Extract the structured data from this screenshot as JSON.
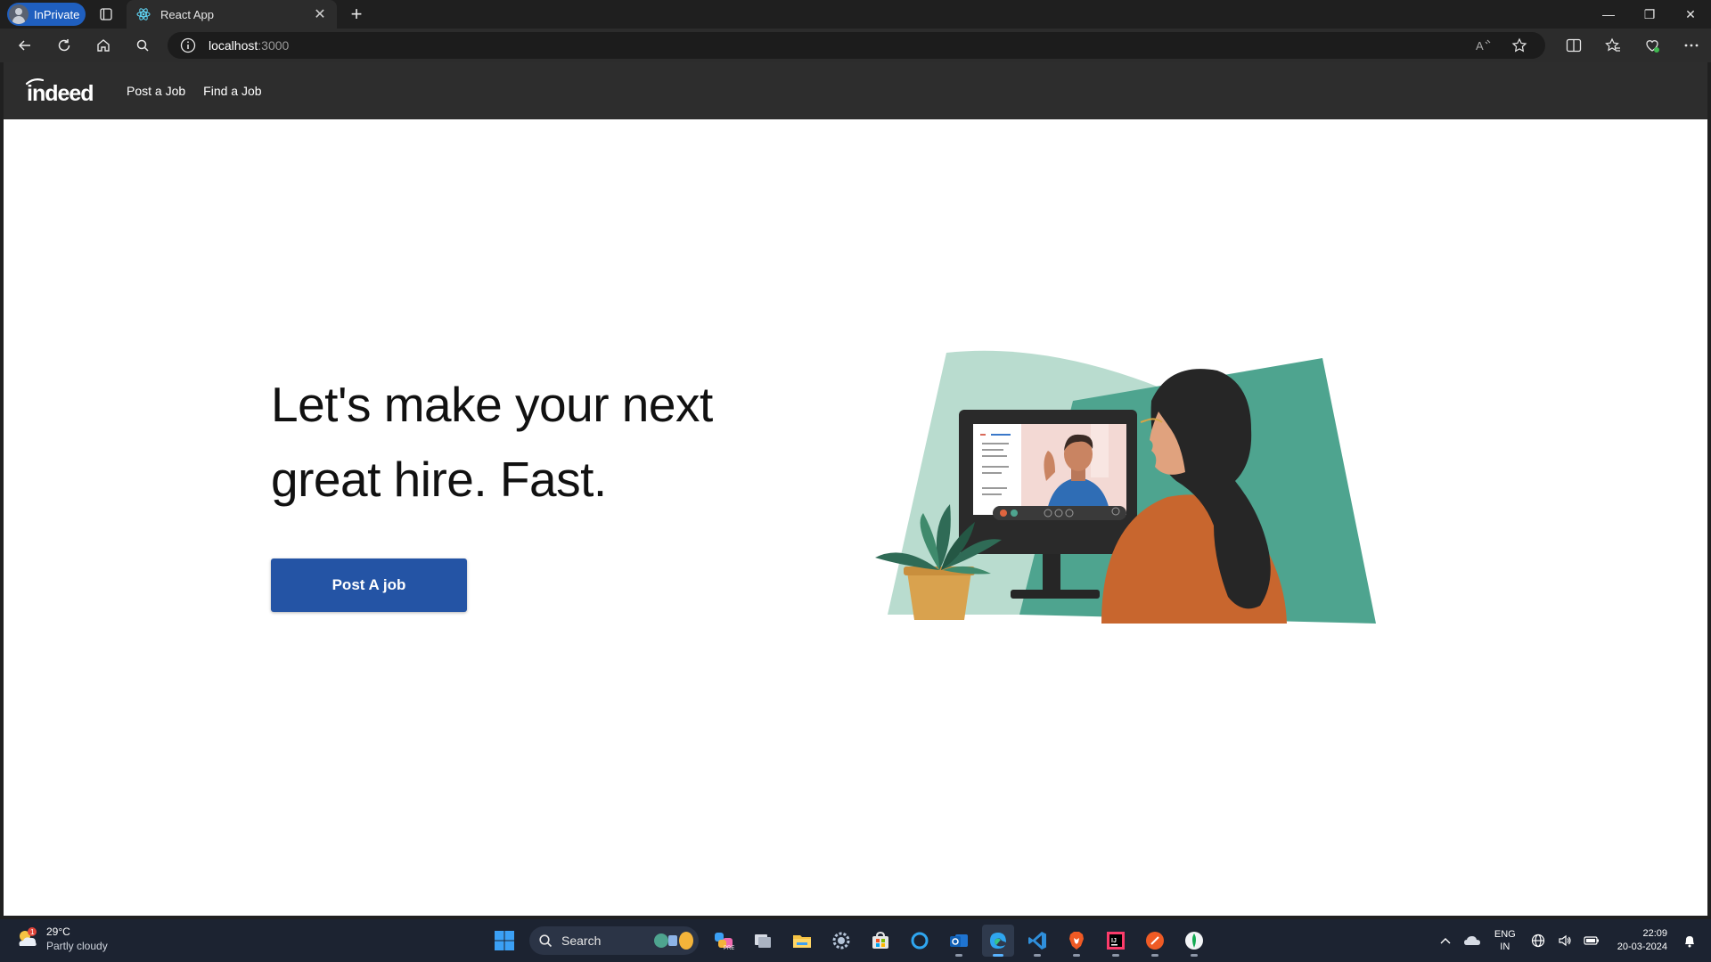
{
  "browser": {
    "profile_label": "InPrivate",
    "tab_title": "React App",
    "url_host": "localhost",
    "url_port": ":3000"
  },
  "app": {
    "logo_text": "indeed",
    "nav": [
      {
        "label": "Post a Job"
      },
      {
        "label": "Find a Job"
      }
    ],
    "hero": {
      "line1": "Let's make your next",
      "line2": "great hire. Fast."
    },
    "cta_label": "Post A job",
    "colors": {
      "nav_bg": "#2d2d2d",
      "cta_bg": "#2454a5",
      "illustration_teal": "#4ea48f",
      "illustration_mint": "#b9dccf",
      "shirt_orange": "#c8662e"
    }
  },
  "taskbar": {
    "weather_temp": "29°C",
    "weather_cond": "Partly cloudy",
    "weather_badge": "1",
    "search_label": "Search",
    "lang_line1": "ENG",
    "lang_line2": "IN",
    "time": "22:09",
    "date": "20-03-2024",
    "icons": [
      "windows-start-icon",
      "search-icon",
      "widgets-icon",
      "copilot-icon",
      "task-view-icon",
      "file-explorer-icon",
      "settings-icon",
      "store-icon",
      "cortana-icon",
      "outlook-icon",
      "edge-icon",
      "vscode-icon",
      "brave-icon",
      "intellij-icon",
      "postman-icon",
      "mongodb-compass-icon"
    ]
  }
}
